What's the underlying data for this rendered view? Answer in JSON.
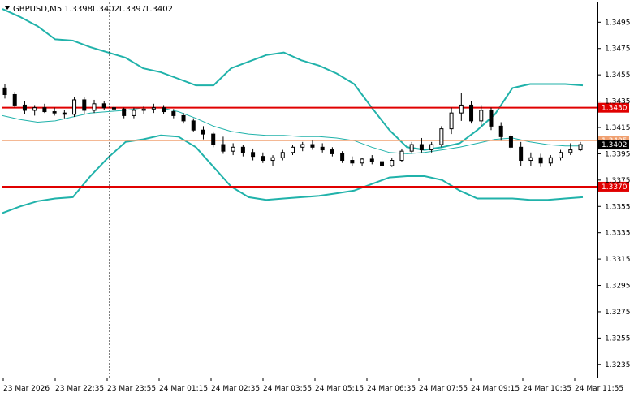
{
  "header": {
    "symbol": "GBPUSD,M5",
    "open": "1.3398",
    "high": "1.3402",
    "low": "1.3397",
    "close": "1.3402"
  },
  "chart_data": {
    "type": "candlestick",
    "symbol": "GBPUSD",
    "timeframe": "M5",
    "ylim": [
      1.3225,
      1.351
    ],
    "y_ticks": [
      "1.3495",
      "1.3475",
      "1.3455",
      "1.3435",
      "1.3415",
      "1.3395",
      "1.3375",
      "1.3355",
      "1.3335",
      "1.3315",
      "1.3295",
      "1.3275",
      "1.3255",
      "1.3235"
    ],
    "x_ticks": [
      "23 Mar 2026",
      "23 Mar 22:35",
      "23 Mar 23:55",
      "24 Mar 01:15",
      "24 Mar 02:35",
      "24 Mar 03:55",
      "24 Mar 05:15",
      "24 Mar 06:35",
      "24 Mar 07:55",
      "24 Mar 09:15",
      "24 Mar 10:35",
      "24 Mar 11:55"
    ],
    "levels": [
      {
        "label": "1.3430",
        "value": 1.343,
        "color": "#e00000"
      },
      {
        "label": "1.3370",
        "value": 1.337,
        "color": "#e00000"
      }
    ],
    "current_price": {
      "label": "1.3402",
      "value": 1.3402
    },
    "ask_line": {
      "label": "1.3405",
      "value": 1.3405,
      "color": "#f0a070"
    },
    "bollinger_upper": [
      1.3505,
      1.3499,
      1.3492,
      1.3482,
      1.3481,
      1.3476,
      1.3472,
      1.3468,
      1.346,
      1.3457,
      1.3452,
      1.3447,
      1.3447,
      1.346,
      1.3465,
      1.347,
      1.3472,
      1.3466,
      1.3462,
      1.3456,
      1.3448,
      1.343,
      1.3413,
      1.34,
      1.3398,
      1.34,
      1.3403,
      1.3413,
      1.3425,
      1.3445,
      1.3448,
      1.3448,
      1.3448,
      1.3447
    ],
    "bollinger_lower": [
      1.335,
      1.3355,
      1.3359,
      1.3361,
      1.3362,
      1.3378,
      1.3392,
      1.3404,
      1.3406,
      1.3409,
      1.3408,
      1.34,
      1.3385,
      1.337,
      1.3362,
      1.336,
      1.3361,
      1.3362,
      1.3363,
      1.3365,
      1.3367,
      1.3372,
      1.3377,
      1.3378,
      1.3378,
      1.3375,
      1.3367,
      1.3361,
      1.3361,
      1.3361,
      1.336,
      1.336,
      1.3361,
      1.3362
    ],
    "moving_average": [
      1.3424,
      1.3421,
      1.3419,
      1.342,
      1.3423,
      1.3426,
      1.3427,
      1.3428,
      1.343,
      1.343,
      1.3427,
      1.3422,
      1.3416,
      1.3412,
      1.341,
      1.3409,
      1.3409,
      1.3408,
      1.3408,
      1.3407,
      1.3405,
      1.34,
      1.3396,
      1.3395,
      1.3396,
      1.3398,
      1.34,
      1.3403,
      1.3406,
      1.3407,
      1.3404,
      1.3402,
      1.3401,
      1.3401
    ],
    "candles": [
      [
        1.3445,
        1.3448,
        1.3437,
        1.344
      ],
      [
        1.344,
        1.3442,
        1.343,
        1.3432
      ],
      [
        1.3432,
        1.3435,
        1.3425,
        1.3428
      ],
      [
        1.3428,
        1.3432,
        1.3424,
        1.343
      ],
      [
        1.343,
        1.3433,
        1.3426,
        1.3427
      ],
      [
        1.3427,
        1.343,
        1.3424,
        1.3426
      ],
      [
        1.3426,
        1.3428,
        1.3422,
        1.3425
      ],
      [
        1.3425,
        1.3438,
        1.3423,
        1.3436
      ],
      [
        1.3436,
        1.3438,
        1.3425,
        1.3428
      ],
      [
        1.3428,
        1.3436,
        1.3426,
        1.3433
      ],
      [
        1.3433,
        1.3435,
        1.3428,
        1.343
      ],
      [
        1.343,
        1.3432,
        1.3427,
        1.3429
      ],
      [
        1.3429,
        1.343,
        1.3422,
        1.3424
      ],
      [
        1.3424,
        1.343,
        1.3422,
        1.3428
      ],
      [
        1.3428,
        1.3431,
        1.3425,
        1.3429
      ],
      [
        1.3429,
        1.3433,
        1.3426,
        1.343
      ],
      [
        1.343,
        1.3432,
        1.3425,
        1.3427
      ],
      [
        1.3427,
        1.3429,
        1.3422,
        1.3424
      ],
      [
        1.3424,
        1.3426,
        1.3418,
        1.342
      ],
      [
        1.342,
        1.3422,
        1.3412,
        1.3413
      ],
      [
        1.3413,
        1.3416,
        1.3406,
        1.341
      ],
      [
        1.341,
        1.3412,
        1.34,
        1.3402
      ],
      [
        1.3402,
        1.3408,
        1.3395,
        1.3397
      ],
      [
        1.3397,
        1.3403,
        1.3394,
        1.34
      ],
      [
        1.34,
        1.3402,
        1.3393,
        1.3396
      ],
      [
        1.3396,
        1.3399,
        1.339,
        1.3393
      ],
      [
        1.3393,
        1.3396,
        1.3388,
        1.339
      ],
      [
        1.339,
        1.3394,
        1.3386,
        1.3392
      ],
      [
        1.3392,
        1.3398,
        1.339,
        1.3396
      ],
      [
        1.3396,
        1.3402,
        1.3394,
        1.34
      ],
      [
        1.34,
        1.3404,
        1.3397,
        1.3402
      ],
      [
        1.3402,
        1.3405,
        1.3398,
        1.34
      ],
      [
        1.34,
        1.3403,
        1.3396,
        1.3398
      ],
      [
        1.3398,
        1.34,
        1.3393,
        1.3395
      ],
      [
        1.3395,
        1.3397,
        1.3388,
        1.339
      ],
      [
        1.339,
        1.3393,
        1.3386,
        1.3388
      ],
      [
        1.3388,
        1.3392,
        1.3386,
        1.3391
      ],
      [
        1.3391,
        1.3394,
        1.3387,
        1.3389
      ],
      [
        1.3389,
        1.3392,
        1.3384,
        1.3386
      ],
      [
        1.3386,
        1.3392,
        1.3385,
        1.339
      ],
      [
        1.339,
        1.3399,
        1.3389,
        1.3397
      ],
      [
        1.3397,
        1.3404,
        1.3395,
        1.3402
      ],
      [
        1.3402,
        1.3407,
        1.3396,
        1.3398
      ],
      [
        1.3398,
        1.3404,
        1.3396,
        1.3402
      ],
      [
        1.3402,
        1.3416,
        1.34,
        1.3414
      ],
      [
        1.3414,
        1.343,
        1.341,
        1.3426
      ],
      [
        1.3426,
        1.3441,
        1.342,
        1.3432
      ],
      [
        1.3432,
        1.3435,
        1.3418,
        1.342
      ],
      [
        1.342,
        1.3432,
        1.3416,
        1.3428
      ],
      [
        1.3428,
        1.343,
        1.3413,
        1.3416
      ],
      [
        1.3416,
        1.3419,
        1.3405,
        1.3408
      ],
      [
        1.3408,
        1.341,
        1.3398,
        1.34
      ],
      [
        1.34,
        1.3404,
        1.3386,
        1.339
      ],
      [
        1.339,
        1.3396,
        1.3386,
        1.3392
      ],
      [
        1.3392,
        1.3395,
        1.3385,
        1.3388
      ],
      [
        1.3388,
        1.3394,
        1.3386,
        1.3392
      ],
      [
        1.3392,
        1.3398,
        1.339,
        1.3396
      ],
      [
        1.3396,
        1.3403,
        1.3394,
        1.3398
      ],
      [
        1.3398,
        1.3404,
        1.3397,
        1.3402
      ]
    ]
  }
}
